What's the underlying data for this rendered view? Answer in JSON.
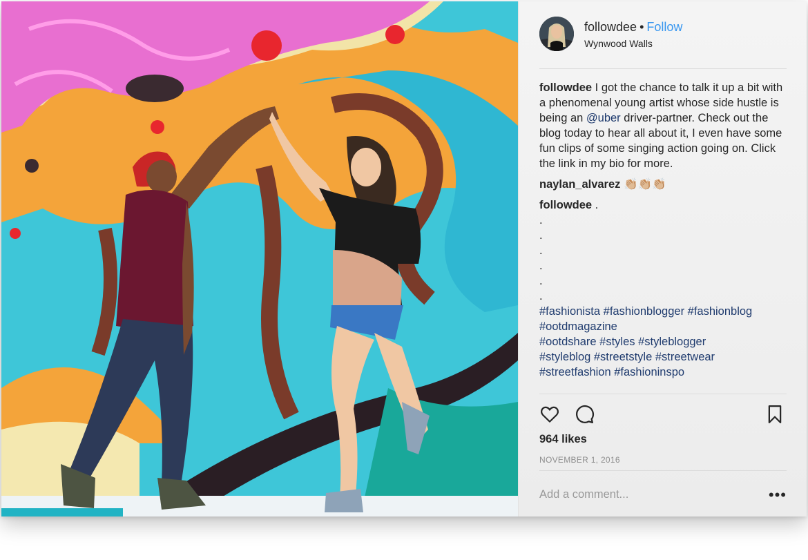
{
  "post": {
    "username": "followdee",
    "separator": "•",
    "follow_label": "Follow",
    "location": "Wynwood Walls",
    "avatar_icon": "profile-photo",
    "photo_description_icon": "mural-photo"
  },
  "caption": {
    "author": "followdee",
    "text_before": " I got the chance to talk it up a bit with a phenomenal young artist whose side hustle is being an ",
    "mention": "@uber",
    "text_after": " driver-partner. Check out the blog today to hear all about it, I even have some fun clips of some singing action going on. Click the link in my bio for more."
  },
  "comments": [
    {
      "author": "naylan_alvarez",
      "text": " 👏🏼👏🏼👏🏼"
    },
    {
      "author": "followdee",
      "text": " .",
      "dots": [
        ".",
        ".",
        ".",
        ".",
        ".",
        "."
      ],
      "hashtag_lines": [
        "#fashionista #fashionblogger #fashionblog",
        "#ootdmagazine",
        "#ootdshare #styles #styleblogger",
        "#styleblog #streetstyle #streetwear",
        "#streetfashion #fashioninspo"
      ]
    }
  ],
  "actions": {
    "like_icon": "heart-icon",
    "comment_icon": "comment-icon",
    "save_icon": "bookmark-icon"
  },
  "likes": "964 likes",
  "date": "NOVEMBER 1, 2016",
  "add_comment": {
    "placeholder": "Add a comment...",
    "more_label": "•••"
  },
  "colors": {
    "link": "#3897f0",
    "hashtag": "#1f3b6e",
    "text": "#262626",
    "muted": "#8e8e8e"
  }
}
